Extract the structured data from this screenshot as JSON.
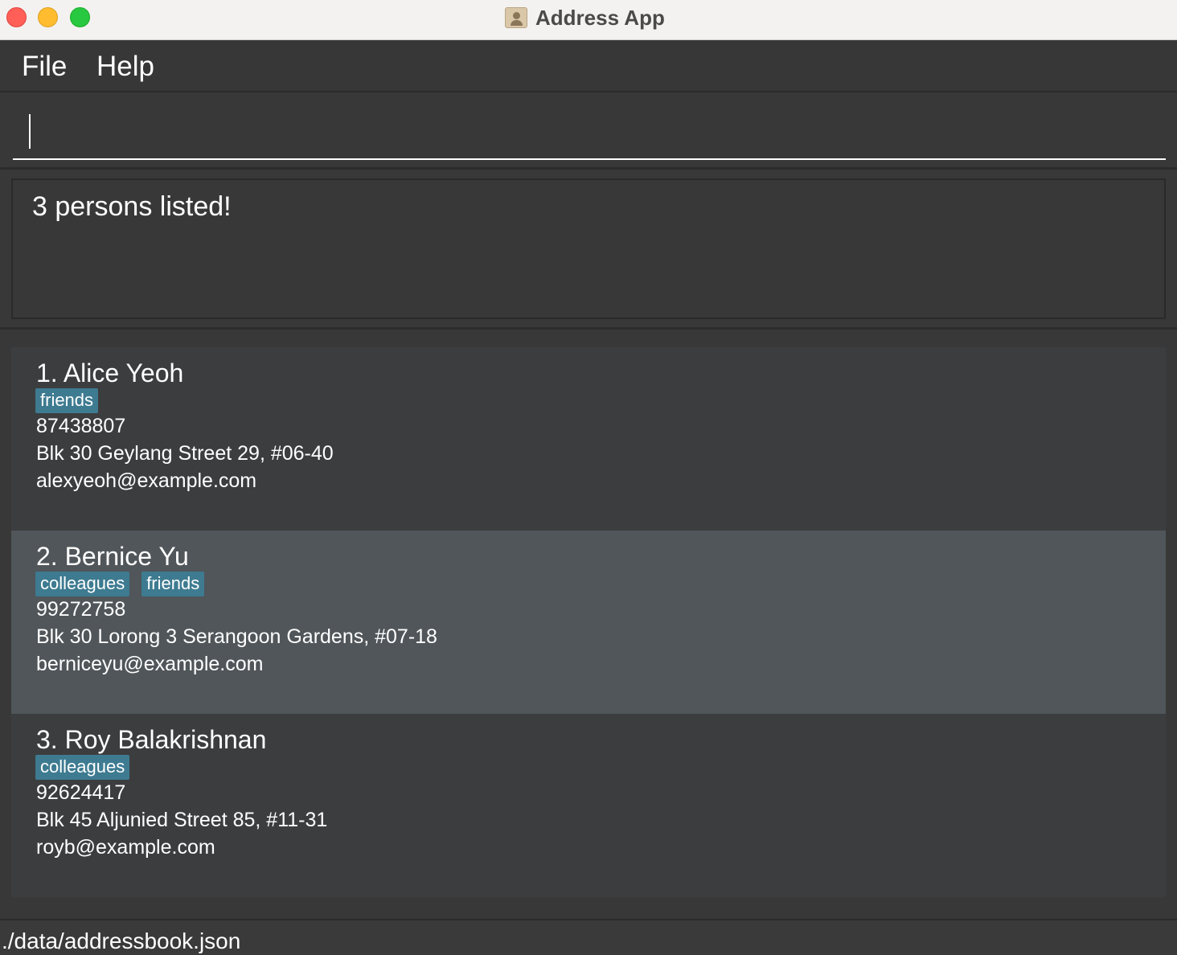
{
  "window": {
    "title": "Address App"
  },
  "menu": {
    "file_label": "File",
    "help_label": "Help"
  },
  "command": {
    "value": "",
    "placeholder": ""
  },
  "result": {
    "message": "3 persons listed!"
  },
  "persons": [
    {
      "name": "1. Alice Yeoh",
      "tags": [
        "friends"
      ],
      "phone": "87438807",
      "address": "Blk 30 Geylang Street 29, #06-40",
      "email": "alexyeoh@example.com",
      "selected": false
    },
    {
      "name": "2. Bernice Yu",
      "tags": [
        "colleagues",
        "friends"
      ],
      "phone": "99272758",
      "address": "Blk 30 Lorong 3 Serangoon Gardens, #07-18",
      "email": "berniceyu@example.com",
      "selected": true
    },
    {
      "name": "3. Roy Balakrishnan",
      "tags": [
        "colleagues"
      ],
      "phone": "92624417",
      "address": "Blk 45 Aljunied Street 85, #11-31",
      "email": "royb@example.com",
      "selected": false
    }
  ],
  "status_bar": {
    "file_path": "./data/addressbook.json"
  },
  "colors": {
    "tag_background": "#3e7b91",
    "selected_card": "#50565a",
    "card": "#3c3d3f",
    "background": "#383838"
  }
}
